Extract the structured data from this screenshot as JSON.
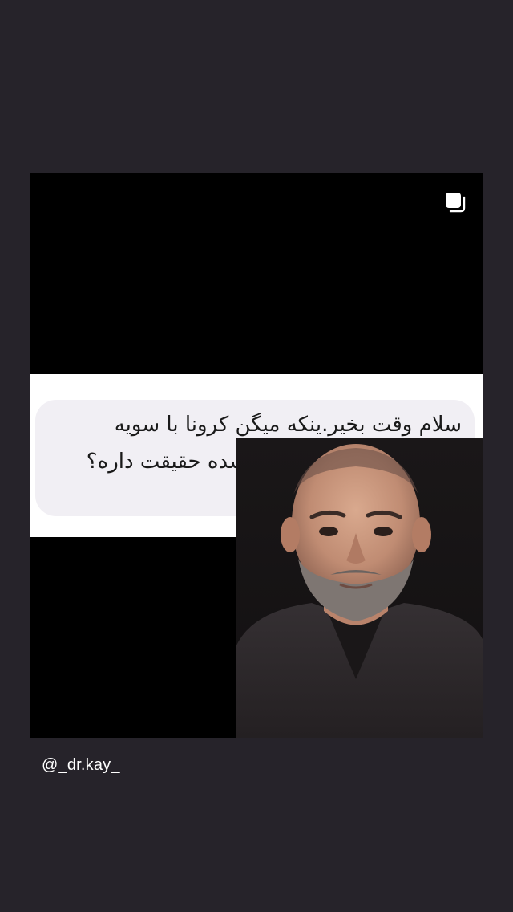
{
  "post": {
    "question_text": "سلام وقت بخیر.ینکه میگن کرونا با سویه جدید        تو ایران شایع شده حقیقت داره؟",
    "multi_post_icon": "multiple-pages-icon"
  },
  "story": {
    "mention": "@_dr.kay_"
  },
  "colors": {
    "background": "#26232a",
    "frame": "#000000",
    "card": "#ffffff",
    "bubble": "#f1eff4",
    "text": "#1a1a1a"
  }
}
